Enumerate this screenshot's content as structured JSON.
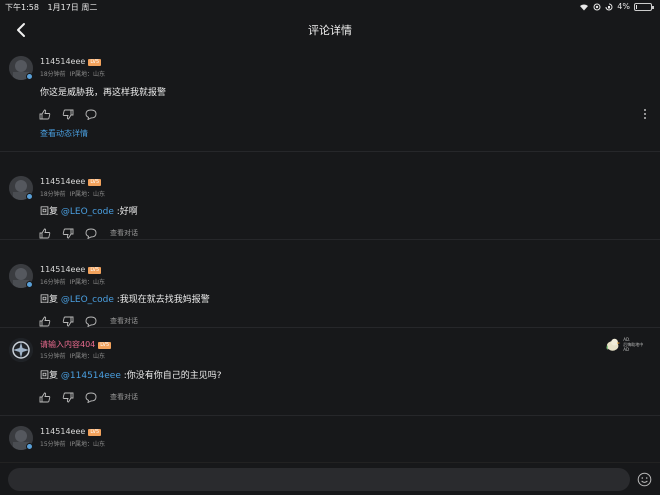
{
  "status": {
    "time": "下午1:58",
    "date": "1月17日 周二",
    "battery_text": "4%",
    "battery_level": 0.04
  },
  "nav": {
    "title": "评论详情"
  },
  "comments": [
    {
      "username": "114514eee",
      "level": "LV5",
      "time": "18分钟前",
      "location": "IP属地：山东",
      "text": "你这是威胁我，再这样我就报警",
      "view_dynamic": "查看动态详情"
    },
    {
      "username": "114514eee",
      "level": "LV5",
      "time": "18分钟前",
      "location": "IP属地：山东",
      "reply_prefix": "回复",
      "mention": "@LEO_code",
      "text": ":好啊",
      "view_conv": "查看对话"
    },
    {
      "username": "114514eee",
      "level": "LV5",
      "time": "16分钟前",
      "location": "IP属地：山东",
      "reply_prefix": "回复",
      "mention": "@LEO_code",
      "text": ":我现在就去找我妈报警",
      "view_conv": "查看对话"
    },
    {
      "username": "请输入内容404",
      "level": "LV5",
      "time": "15分钟前",
      "location": "IP属地：山东",
      "reply_prefix": "回复",
      "mention": "@114514eee",
      "text": ":你没有你自己的主见吗?",
      "view_conv": "查看对话",
      "badge_line1": "AD.",
      "badge_line2": "后悔助地中AD"
    },
    {
      "username": "114514eee",
      "level": "LV5",
      "time": "15分钟前",
      "location": "IP属地：山东"
    }
  ],
  "input": {
    "placeholder": "",
    "value": ""
  },
  "colors": {
    "background": "#17181a",
    "link": "#4a9fe0",
    "pink_name": "#e86a8e",
    "level_badge": "#f2a25c"
  }
}
